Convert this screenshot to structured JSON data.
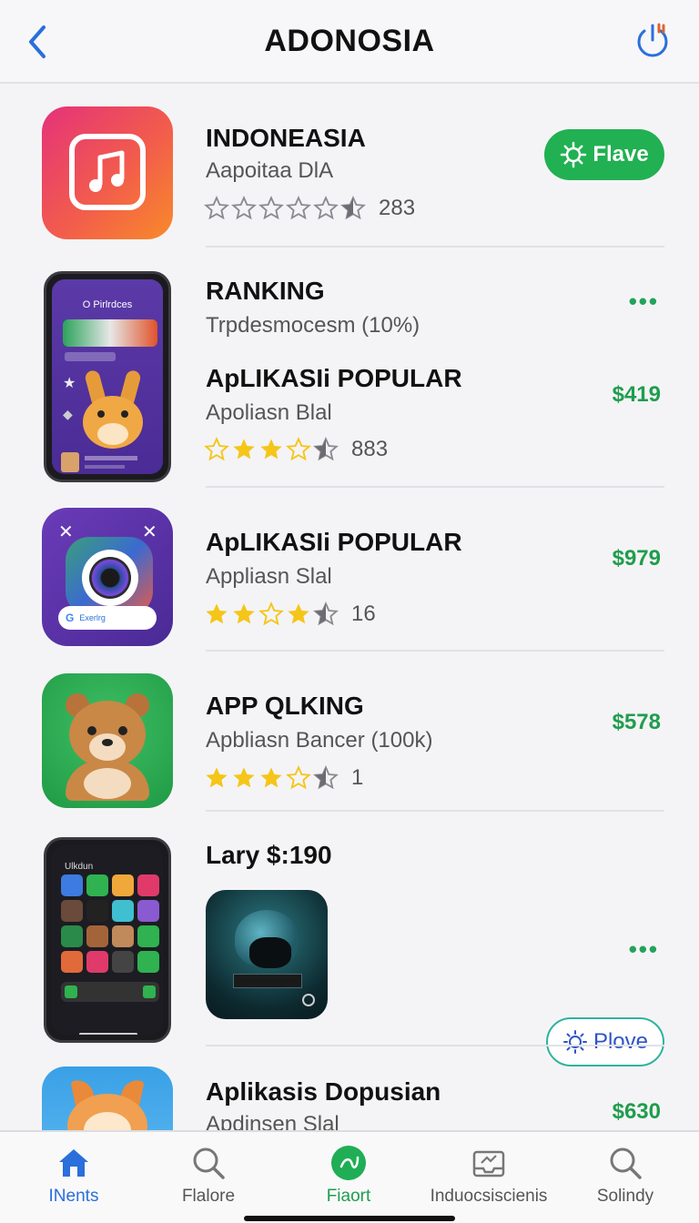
{
  "header": {
    "title": "ADONOSIA"
  },
  "items": [
    {
      "title": "INDONEASIA",
      "subtitle": "Aapoitaa DlA",
      "rating_count": "283",
      "button_label": "Flave"
    },
    {
      "title": "RANKING",
      "subtitle": "Trpdesmocesm (10%)",
      "more": "•••",
      "phone_header": "O Pirlrdces"
    },
    {
      "title": "ApLIKASIi POPULAR",
      "subtitle": "Apoliasn Blal",
      "rating_count": "883",
      "price": "$419"
    },
    {
      "title": "ApLIKASIi POPULAR",
      "subtitle": "Appliasn Slal",
      "rating_count": "16",
      "price": "$979",
      "search_label": "Exerlrg"
    },
    {
      "title": "APP QLKING",
      "subtitle": "Apbliasn Bancer (100k)",
      "rating_count": "1",
      "price": "$578"
    },
    {
      "title": "Lary $:190",
      "more": "•••",
      "button_label": "Plove",
      "phone_header": "Ulkdun"
    },
    {
      "title": "Aplikasis Dopusian",
      "subtitle": "Apdinsen Slal",
      "price": "$630"
    }
  ],
  "tabs": [
    {
      "label": "INents",
      "icon": "home-icon"
    },
    {
      "label": "Flalore",
      "icon": "search-icon"
    },
    {
      "label": "Fiaort",
      "icon": "play-icon"
    },
    {
      "label": "Induocsiscienis",
      "icon": "inbox-icon"
    },
    {
      "label": "Solindy",
      "icon": "search-icon"
    }
  ],
  "colors": {
    "accent_blue": "#2a6fdb",
    "price_green": "#1f9d4d",
    "button_green": "#21b052",
    "star_yellow": "#f5c518"
  }
}
